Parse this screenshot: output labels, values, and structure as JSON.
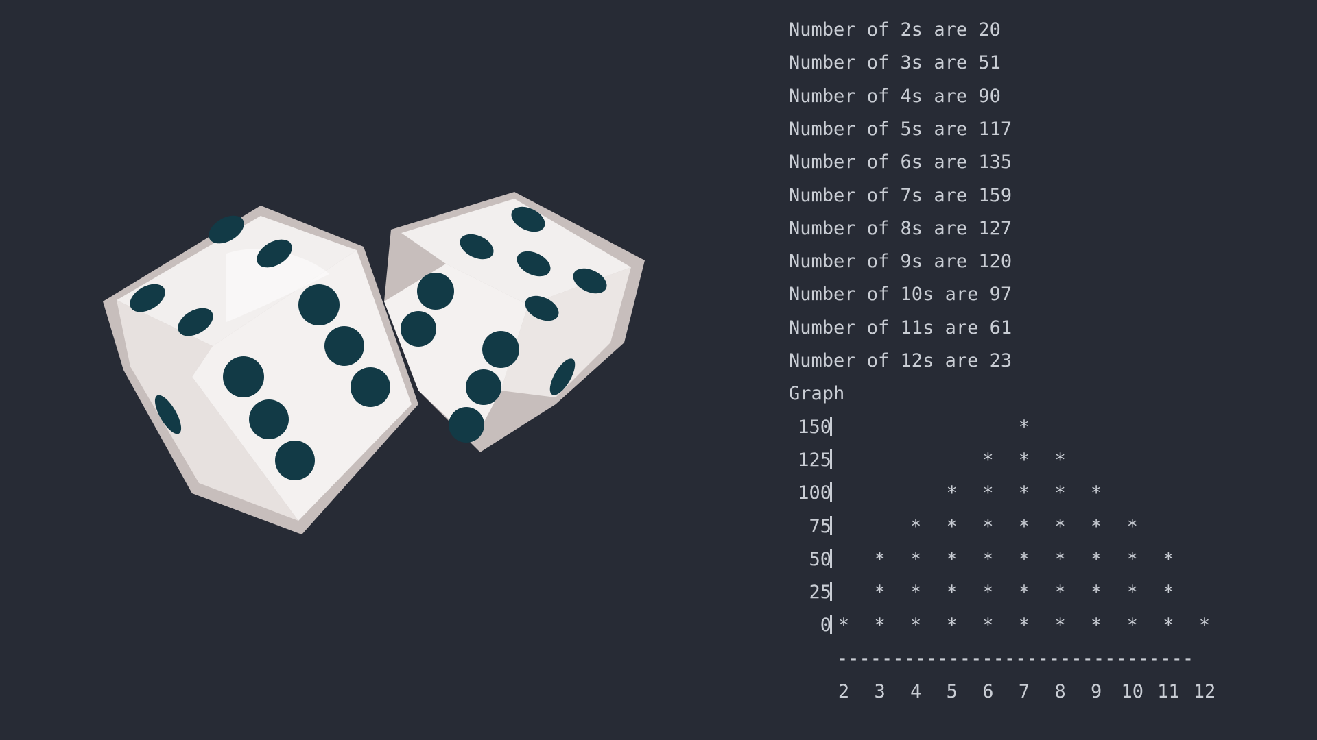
{
  "counts_lines": [
    "Number of 2s are 20",
    "Number of 3s are 51",
    "Number of 4s are 90",
    "Number of 5s are 117",
    "Number of 6s are 135",
    "Number of 7s are 159",
    "Number of 8s are 127",
    "Number of 9s are 120",
    "Number of 10s are 97",
    "Number of 11s are 61",
    "Number of 12s are 23"
  ],
  "graph_heading": "Graph",
  "axis_rule_text": "--------------------------------",
  "chart_data": {
    "type": "scatter",
    "title": "Graph",
    "xlabel": "",
    "ylabel": "",
    "categories": [
      "2",
      "3",
      "4",
      "5",
      "6",
      "7",
      "8",
      "9",
      "10",
      "11",
      "12"
    ],
    "values": [
      20,
      51,
      90,
      117,
      135,
      159,
      127,
      120,
      97,
      61,
      23
    ],
    "y_ticks": [
      150,
      125,
      100,
      75,
      50,
      25,
      0
    ],
    "ylim": [
      0,
      150
    ],
    "grid": false,
    "legend": "none",
    "mark_glyph": "*"
  },
  "colors": {
    "background": "#272b35",
    "text": "#c9cdd4",
    "die_face": "#f2efee",
    "die_shadow": "#d9d2d0",
    "die_edge": "#c7bebc",
    "pip": "#123a46"
  },
  "icons": [
    "dice-icon"
  ]
}
